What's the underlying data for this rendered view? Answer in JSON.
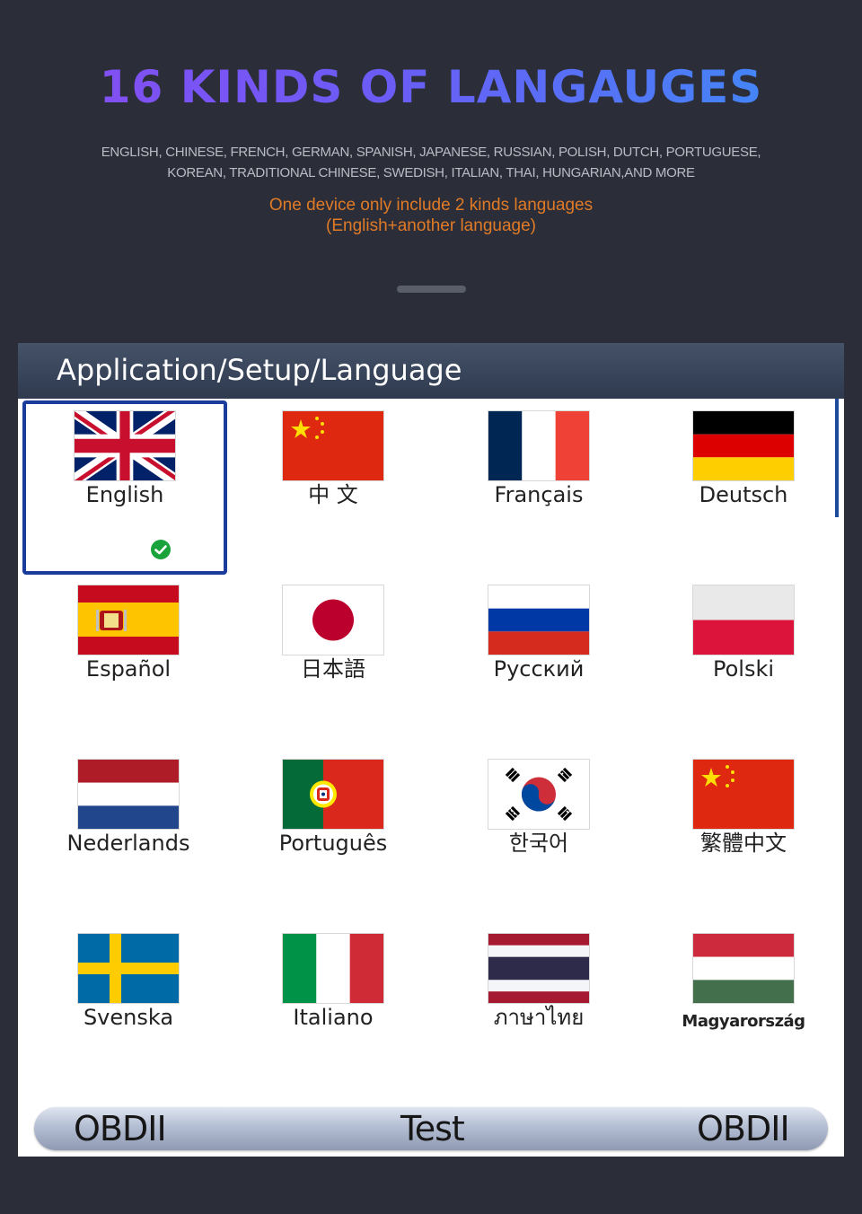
{
  "headline": "16 KINDS OF LANGAUGES",
  "languages_list": [
    "ENGLISH, CHINESE, FRENCH, GERMAN, SPANISH, JAPANESE, RUSSIAN, POLISH, DUTCH, PORTUGUESE,",
    "KOREAN, TRADITIONAL CHINESE, SWEDISH, ITALIAN, THAI, HUNGARIAN,AND MORE"
  ],
  "note": [
    "One device only include 2 kinds languages",
    "(English+another language)"
  ],
  "colors": {
    "background": "#2b2e38",
    "headline_gradient_start": "#8a4bf2",
    "headline_gradient_end": "#3a8ff8",
    "note": "#e07a26",
    "selection_border": "#1a3c9a",
    "check": "#1aa33a"
  },
  "screen": {
    "title": "Application/Setup/Language",
    "selected_language": "English",
    "languages": [
      {
        "label": "English",
        "flag": "uk-flag-icon"
      },
      {
        "label": "中 文",
        "flag": "china-flag-icon"
      },
      {
        "label": "Français",
        "flag": "france-flag-icon"
      },
      {
        "label": "Deutsch",
        "flag": "germany-flag-icon"
      },
      {
        "label": "Español",
        "flag": "spain-flag-icon"
      },
      {
        "label": "日本語",
        "flag": "japan-flag-icon"
      },
      {
        "label": "Русский",
        "flag": "russia-flag-icon"
      },
      {
        "label": "Polski",
        "flag": "poland-flag-icon"
      },
      {
        "label": "Nederlands",
        "flag": "netherlands-flag-icon"
      },
      {
        "label": "Português",
        "flag": "portugal-flag-icon"
      },
      {
        "label": "한국어",
        "flag": "korea-flag-icon"
      },
      {
        "label": "繁體中文",
        "flag": "china-flag-icon"
      },
      {
        "label": "Svenska",
        "flag": "sweden-flag-icon"
      },
      {
        "label": "Italiano",
        "flag": "italy-flag-icon"
      },
      {
        "label": "ภาษาไทย",
        "flag": "thailand-flag-icon"
      },
      {
        "label": "Magyarország",
        "flag": "hungary-flag-icon"
      }
    ],
    "footer": {
      "left": "OBDII",
      "center": "Test",
      "right": "OBDII"
    }
  }
}
